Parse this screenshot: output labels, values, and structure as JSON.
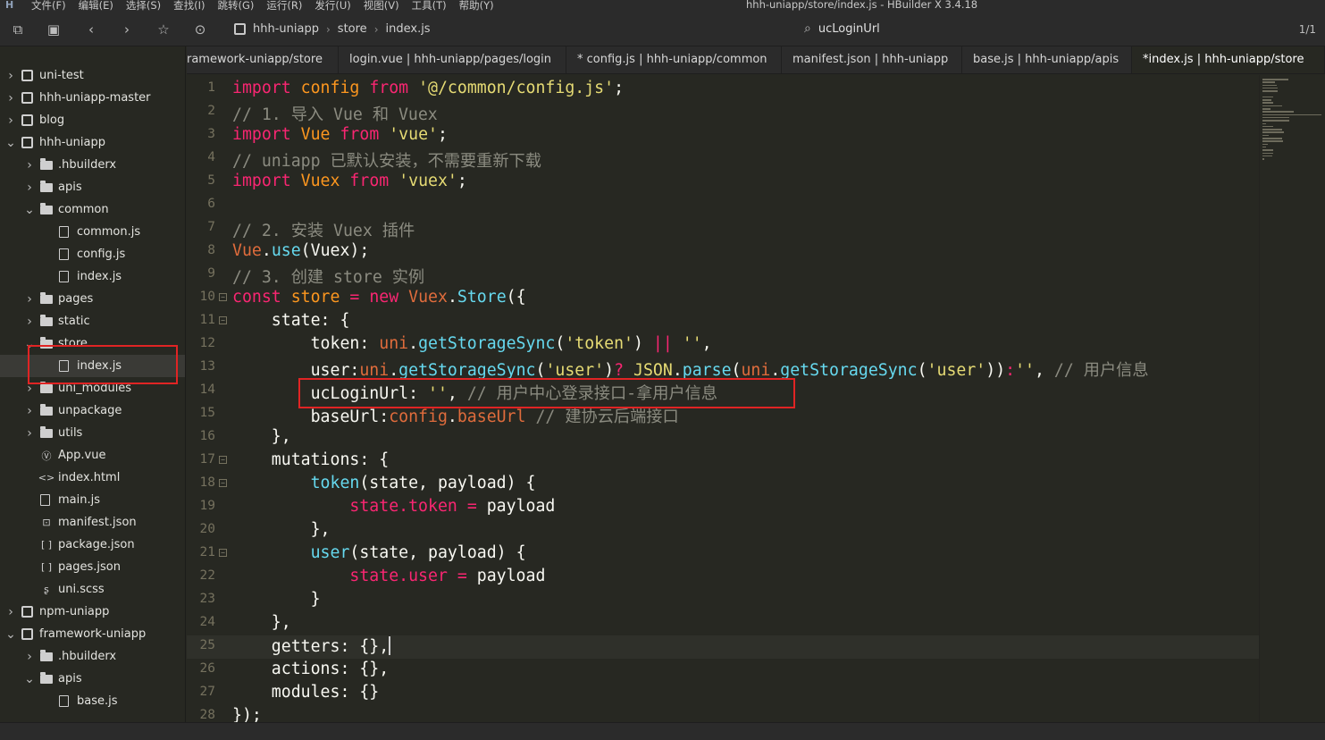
{
  "window": {
    "title": "hhh-uniapp/store/index.js - HBuilder X 3.4.18",
    "logo_icon": "hbuilder-logo-icon",
    "menu": [
      "文件(F)",
      "编辑(E)",
      "选择(S)",
      "查找(I)",
      "跳转(G)",
      "运行(R)",
      "发行(U)",
      "视图(V)",
      "工具(T)",
      "帮助(Y)"
    ]
  },
  "toolbar": {
    "icons": [
      "new-file-icon",
      "save-icon",
      "back-icon",
      "forward-icon",
      "star-icon",
      "run-icon"
    ],
    "breadcrumb": [
      "hhh-uniapp",
      "store",
      "index.js"
    ],
    "search_text": "ucLoginUrl",
    "page_indicator": "1/1"
  },
  "tabs": [
    {
      "label": "ramework-uniapp/store"
    },
    {
      "label": "login.vue | hhh-uniapp/pages/login"
    },
    {
      "label": "* config.js | hhh-uniapp/common"
    },
    {
      "label": "manifest.json | hhh-uniapp"
    },
    {
      "label": "base.js | hhh-uniapp/apis"
    },
    {
      "label": "*index.js | hhh-uniapp/store"
    }
  ],
  "tree": [
    {
      "label": "uni-test",
      "indent": 0,
      "chev": "▶",
      "icon": "project-icon"
    },
    {
      "label": "hhh-uniapp-master",
      "indent": 0,
      "chev": "▶",
      "icon": "project-icon"
    },
    {
      "label": "blog",
      "indent": 0,
      "chev": "▶",
      "icon": "project-icon"
    },
    {
      "label": "hhh-uniapp",
      "indent": 0,
      "chev": "▼",
      "icon": "project-icon"
    },
    {
      "label": ".hbuilderx",
      "indent": 1,
      "chev": "▶",
      "icon": "folder-icon"
    },
    {
      "label": "apis",
      "indent": 1,
      "chev": "▶",
      "icon": "folder-icon"
    },
    {
      "label": "common",
      "indent": 1,
      "chev": "▼",
      "icon": "folder-open-icon"
    },
    {
      "label": "common.js",
      "indent": 2,
      "chev": "",
      "icon": "js-file-icon"
    },
    {
      "label": "config.js",
      "indent": 2,
      "chev": "",
      "icon": "js-file-icon"
    },
    {
      "label": "index.js",
      "indent": 2,
      "chev": "",
      "icon": "js-file-icon"
    },
    {
      "label": "pages",
      "indent": 1,
      "chev": "▶",
      "icon": "folder-icon"
    },
    {
      "label": "static",
      "indent": 1,
      "chev": "▶",
      "icon": "folder-icon"
    },
    {
      "label": "store",
      "indent": 1,
      "chev": "▼",
      "icon": "folder-open-icon"
    },
    {
      "label": "index.js",
      "indent": 2,
      "chev": "",
      "icon": "js-file-icon",
      "selected": true
    },
    {
      "label": "uni_modules",
      "indent": 1,
      "chev": "▶",
      "icon": "folder-icon"
    },
    {
      "label": "unpackage",
      "indent": 1,
      "chev": "▶",
      "icon": "folder-icon"
    },
    {
      "label": "utils",
      "indent": 1,
      "chev": "▶",
      "icon": "folder-icon"
    },
    {
      "label": "App.vue",
      "indent": 1,
      "chev": "",
      "icon": "vue-file-icon"
    },
    {
      "label": "index.html",
      "indent": 1,
      "chev": "",
      "icon": "html-file-icon"
    },
    {
      "label": "main.js",
      "indent": 1,
      "chev": "",
      "icon": "js-file-icon"
    },
    {
      "label": "manifest.json",
      "indent": 1,
      "chev": "",
      "icon": "manifest-file-icon"
    },
    {
      "label": "package.json",
      "indent": 1,
      "chev": "",
      "icon": "json-file-icon"
    },
    {
      "label": "pages.json",
      "indent": 1,
      "chev": "",
      "icon": "json-file-icon"
    },
    {
      "label": "uni.scss",
      "indent": 1,
      "chev": "",
      "icon": "scss-file-icon"
    },
    {
      "label": "npm-uniapp",
      "indent": 0,
      "chev": "▶",
      "icon": "project-icon"
    },
    {
      "label": "framework-uniapp",
      "indent": 0,
      "chev": "▼",
      "icon": "project-icon"
    },
    {
      "label": ".hbuilderx",
      "indent": 1,
      "chev": "▶",
      "icon": "folder-icon"
    },
    {
      "label": "apis",
      "indent": 1,
      "chev": "▼",
      "icon": "folder-open-icon"
    },
    {
      "label": "base.js",
      "indent": 2,
      "chev": "",
      "icon": "js-file-icon"
    }
  ],
  "code_lines": [
    {
      "n": "1",
      "tokens": [
        [
          "kw",
          "import"
        ],
        [
          "p",
          " "
        ],
        [
          "var",
          "config"
        ],
        [
          "p",
          " "
        ],
        [
          "kw",
          "from"
        ],
        [
          "p",
          " "
        ],
        [
          "str",
          "'@/common/config.js'"
        ],
        [
          "p",
          ";"
        ]
      ]
    },
    {
      "n": "2",
      "tokens": [
        [
          "cm",
          "// 1. 导入 Vue 和 Vuex"
        ]
      ]
    },
    {
      "n": "3",
      "tokens": [
        [
          "kw",
          "import"
        ],
        [
          "p",
          " "
        ],
        [
          "var",
          "Vue"
        ],
        [
          "p",
          " "
        ],
        [
          "kw",
          "from"
        ],
        [
          "p",
          " "
        ],
        [
          "str",
          "'vue'"
        ],
        [
          "p",
          ";"
        ]
      ]
    },
    {
      "n": "4",
      "tokens": [
        [
          "cm",
          "// uniapp 已默认安装，不需要重新下载"
        ]
      ]
    },
    {
      "n": "5",
      "tokens": [
        [
          "kw",
          "import"
        ],
        [
          "p",
          " "
        ],
        [
          "var",
          "Vuex"
        ],
        [
          "p",
          " "
        ],
        [
          "kw",
          "from"
        ],
        [
          "p",
          " "
        ],
        [
          "str",
          "'vuex'"
        ],
        [
          "p",
          ";"
        ]
      ]
    },
    {
      "n": "6",
      "tokens": []
    },
    {
      "n": "7",
      "tokens": [
        [
          "cm",
          "// 2. 安装 Vuex 插件"
        ]
      ]
    },
    {
      "n": "8",
      "tokens": [
        [
          "cls",
          "Vue"
        ],
        [
          "p",
          "."
        ],
        [
          "fn",
          "use"
        ],
        [
          "p",
          "(Vuex);"
        ]
      ]
    },
    {
      "n": "9",
      "tokens": [
        [
          "cm",
          "// 3. 创建 store 实例"
        ]
      ]
    },
    {
      "n": "10",
      "fold": true,
      "tokens": [
        [
          "kw",
          "const"
        ],
        [
          "p",
          " "
        ],
        [
          "var",
          "store"
        ],
        [
          "p",
          " "
        ],
        [
          "kw",
          "="
        ],
        [
          "p",
          " "
        ],
        [
          "kw",
          "new"
        ],
        [
          "p",
          " "
        ],
        [
          "cls",
          "Vuex"
        ],
        [
          "p",
          "."
        ],
        [
          "fn",
          "Store"
        ],
        [
          "p",
          "({"
        ]
      ]
    },
    {
      "n": "11",
      "fold": true,
      "tokens": [
        [
          "p",
          "    state: {"
        ]
      ]
    },
    {
      "n": "12",
      "tokens": [
        [
          "p",
          "        token: "
        ],
        [
          "cls",
          "uni"
        ],
        [
          "p",
          "."
        ],
        [
          "fn",
          "getStorageSync"
        ],
        [
          "p",
          "("
        ],
        [
          "str",
          "'token'"
        ],
        [
          "p",
          ") "
        ],
        [
          "kw",
          "||"
        ],
        [
          "p",
          " "
        ],
        [
          "str",
          "''"
        ],
        [
          "p",
          ","
        ]
      ]
    },
    {
      "n": "13",
      "tokens": [
        [
          "p",
          "        user:"
        ],
        [
          "cls",
          "uni"
        ],
        [
          "p",
          "."
        ],
        [
          "fn",
          "getStorageSync"
        ],
        [
          "p",
          "("
        ],
        [
          "str",
          "'user'"
        ],
        [
          "p",
          ")"
        ],
        [
          "kw",
          "?"
        ],
        [
          "p",
          " "
        ],
        [
          "str",
          "JSON"
        ],
        [
          "p",
          "."
        ],
        [
          "fn",
          "parse"
        ],
        [
          "p",
          "("
        ],
        [
          "cls",
          "uni"
        ],
        [
          "p",
          "."
        ],
        [
          "fn",
          "getStorageSync"
        ],
        [
          "p",
          "("
        ],
        [
          "str",
          "'user'"
        ],
        [
          "p",
          "))"
        ],
        [
          "kw",
          ":"
        ],
        [
          "str",
          "''"
        ],
        [
          "p",
          ", "
        ],
        [
          "cm",
          "// 用户信息"
        ]
      ]
    },
    {
      "n": "14",
      "tokens": [
        [
          "p",
          "        ucLoginUrl: "
        ],
        [
          "str",
          "''"
        ],
        [
          "p",
          ", "
        ],
        [
          "cm",
          "// 用户中心登录接口-拿用户信息"
        ]
      ]
    },
    {
      "n": "15",
      "tokens": [
        [
          "p",
          "        baseUrl:"
        ],
        [
          "cls",
          "config"
        ],
        [
          "p",
          "."
        ],
        [
          "cls",
          "baseUrl"
        ],
        [
          "p",
          " "
        ],
        [
          "cm",
          "// 建协云后端接口"
        ]
      ]
    },
    {
      "n": "16",
      "tokens": [
        [
          "p",
          "    },"
        ]
      ]
    },
    {
      "n": "17",
      "fold": true,
      "tokens": [
        [
          "p",
          "    mutations: {"
        ]
      ]
    },
    {
      "n": "18",
      "fold": true,
      "tokens": [
        [
          "p",
          "        "
        ],
        [
          "fn",
          "token"
        ],
        [
          "p",
          "(state, payload) {"
        ]
      ]
    },
    {
      "n": "19",
      "tokens": [
        [
          "p",
          "            "
        ],
        [
          "kw",
          "state.token"
        ],
        [
          "p",
          " "
        ],
        [
          "kw",
          "="
        ],
        [
          "p",
          " payload"
        ]
      ]
    },
    {
      "n": "20",
      "tokens": [
        [
          "p",
          "        },"
        ]
      ]
    },
    {
      "n": "21",
      "fold": true,
      "tokens": [
        [
          "p",
          "        "
        ],
        [
          "fn",
          "user"
        ],
        [
          "p",
          "(state, payload) {"
        ]
      ]
    },
    {
      "n": "22",
      "tokens": [
        [
          "p",
          "            "
        ],
        [
          "kw",
          "state.user"
        ],
        [
          "p",
          " "
        ],
        [
          "kw",
          "="
        ],
        [
          "p",
          " payload"
        ]
      ]
    },
    {
      "n": "23",
      "tokens": [
        [
          "p",
          "        }"
        ]
      ]
    },
    {
      "n": "24",
      "tokens": [
        [
          "p",
          "    },"
        ]
      ]
    },
    {
      "n": "25",
      "current": true,
      "cursor": true,
      "tokens": [
        [
          "p",
          "    getters: {},"
        ]
      ]
    },
    {
      "n": "26",
      "tokens": [
        [
          "p",
          "    actions: {},"
        ]
      ]
    },
    {
      "n": "27",
      "tokens": [
        [
          "p",
          "    modules: {}"
        ]
      ]
    },
    {
      "n": "28",
      "tokens": [
        [
          "p",
          "});"
        ]
      ]
    }
  ],
  "colors": {
    "editor_bg": "#272822",
    "keyword": "#f92672",
    "string": "#e6db74",
    "comment": "#8b8b80",
    "function": "#66d9ef",
    "annotation_box": "#e02424"
  }
}
